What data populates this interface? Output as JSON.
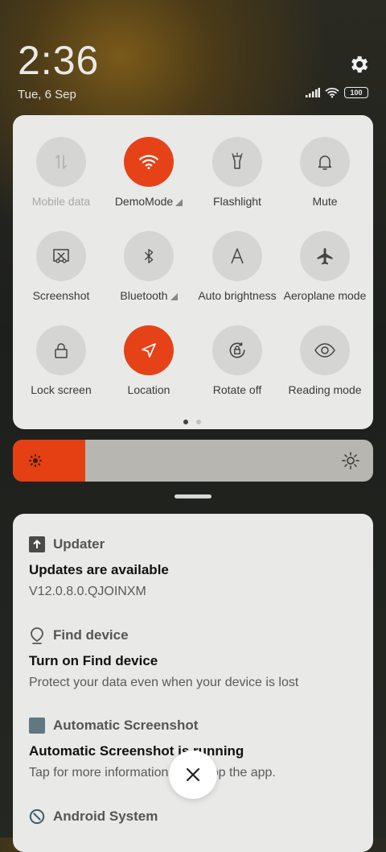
{
  "status": {
    "time": "2:36",
    "date": "Tue, 6 Sep",
    "battery": "100",
    "icons": [
      "signal-icon",
      "wifi-icon",
      "battery-icon"
    ]
  },
  "settings_icon": "gear-icon",
  "quick_settings": {
    "tiles": [
      {
        "label": "Mobile data",
        "icon": "mobile-data-icon",
        "state": "disabled"
      },
      {
        "label": "DemoMode",
        "icon": "wifi-icon",
        "state": "on",
        "expandable": true
      },
      {
        "label": "Flashlight",
        "icon": "flashlight-icon",
        "state": "off"
      },
      {
        "label": "Mute",
        "icon": "bell-icon",
        "state": "off"
      },
      {
        "label": "Screenshot",
        "icon": "scissors-icon",
        "state": "off"
      },
      {
        "label": "Bluetooth",
        "icon": "bluetooth-icon",
        "state": "off",
        "expandable": true
      },
      {
        "label": "Auto brightness",
        "icon": "letter-a-icon",
        "state": "off"
      },
      {
        "label": "Aeroplane mode",
        "icon": "airplane-icon",
        "state": "off"
      },
      {
        "label": "Lock screen",
        "icon": "lock-icon",
        "state": "off"
      },
      {
        "label": "Location",
        "icon": "location-arrow-icon",
        "state": "on"
      },
      {
        "label": "Rotate off",
        "icon": "rotate-lock-icon",
        "state": "off"
      },
      {
        "label": "Reading mode",
        "icon": "eye-icon",
        "state": "off"
      }
    ],
    "pages": 2,
    "current_page": 1
  },
  "brightness": {
    "level": 0.2
  },
  "colors": {
    "accent": "#e64218",
    "panel": "#e9e9e8"
  },
  "notifications": [
    {
      "app": "Updater",
      "icon": "upload-icon",
      "title": "Updates are available",
      "body": "V12.0.8.0.QJOINXM"
    },
    {
      "app": "Find device",
      "icon": "location-pin-icon",
      "title": "Turn on Find device",
      "body": "Protect your data even when your device is lost"
    },
    {
      "app": "Automatic Screenshot",
      "icon": "square-icon",
      "title": "Automatic Screenshot is running",
      "body": "Tap for more information or to stop the app."
    },
    {
      "app": "Android System",
      "icon": "android-system-icon"
    }
  ],
  "clear_button": {
    "icon": "close-icon"
  }
}
